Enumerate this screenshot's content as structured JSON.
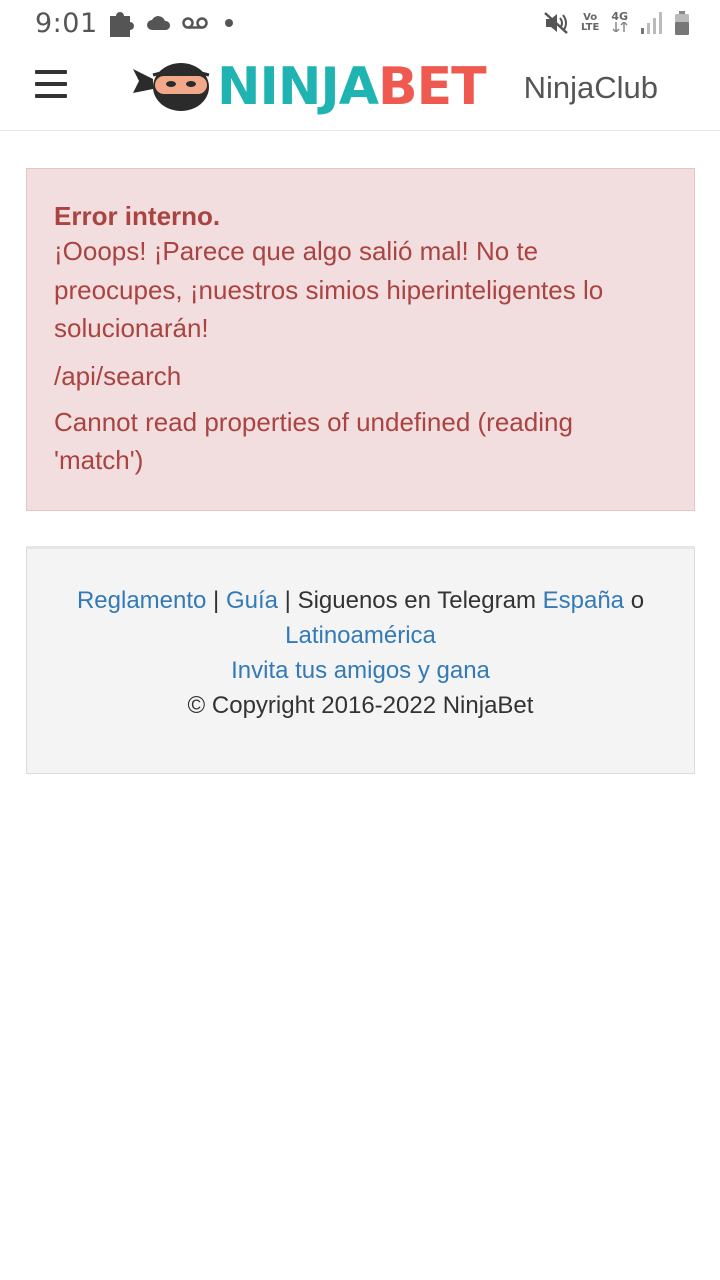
{
  "status_bar": {
    "time": "9:01",
    "icons": [
      "puzzle-icon",
      "cloud-icon",
      "voicemail-icon",
      "dot-icon",
      "mute-icon",
      "volte-icon",
      "4g-icon",
      "signal-icon",
      "battery-icon"
    ],
    "volte_top": "Vo",
    "volte_bottom": "LTE",
    "network": "4G"
  },
  "header": {
    "menu_icon": "hamburger-icon",
    "logo_part1": "NINJA",
    "logo_part2": "BET",
    "club_link": "NinjaClub",
    "colors": {
      "teal": "#1fb3b2",
      "red": "#ef5a50"
    }
  },
  "error": {
    "title": "Error interno.",
    "message": "¡Ooops! ¡Parece que algo salió mal! No te preocupes, ¡nuestros simios hiperinteligentes lo solucionarán!",
    "path": "/api/search",
    "detail": "Cannot read properties of undefined (reading 'match')",
    "colors": {
      "background": "#f2dede",
      "text": "#a94442"
    }
  },
  "footer": {
    "link_rules": "Reglamento",
    "sep1": " | ",
    "link_guide": "Guía",
    "sep2": " | ",
    "telegram_text": "Siguenos en Telegram ",
    "link_spain": "España",
    "or_text": " o",
    "link_latam": "Latinoamérica",
    "link_invite": "Invita tus amigos y gana",
    "copyright": "© Copyright 2016-2022 NinjaBet",
    "link_color": "#337ab7"
  }
}
